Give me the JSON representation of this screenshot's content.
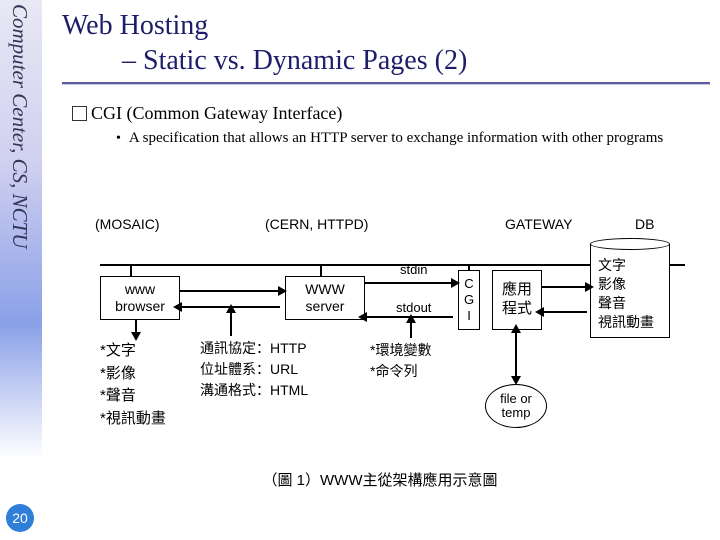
{
  "sidebar": {
    "org": "Computer Center, CS, NCTU"
  },
  "slide_number": "20",
  "title": {
    "line1": "Web Hosting",
    "line2": "– Static vs. Dynamic Pages (2)"
  },
  "body": {
    "bullet": "CGI (Common Gateway Interface)",
    "sub": "A specification that allows an HTTP server to exchange information with other programs"
  },
  "diagram": {
    "mosaic_label": "(MOSAIC)",
    "cern_label": "(CERN, HTTPD)",
    "gateway_label": "GATEWAY",
    "db_label": "DB",
    "browser_box": "www\nbrowser",
    "server_box": "WWW\nserver",
    "cgi_box": "C\nG\nI",
    "app_box": "應用\n程式",
    "stdin": "stdin",
    "stdout": "stdout",
    "media_label": "*文字\n*影像\n*聲音\n*視訊動畫",
    "proto_label": "通訊協定：HTTP\n位址體系：URL\n溝通格式：HTML",
    "env_label": "*環境變數\n*命令列",
    "db_media": "文字\n影像\n聲音\n視訊動畫",
    "file_ellipse": "file or\ntemp",
    "caption": "（圖 1）WWW主從架構應用示意圖"
  }
}
